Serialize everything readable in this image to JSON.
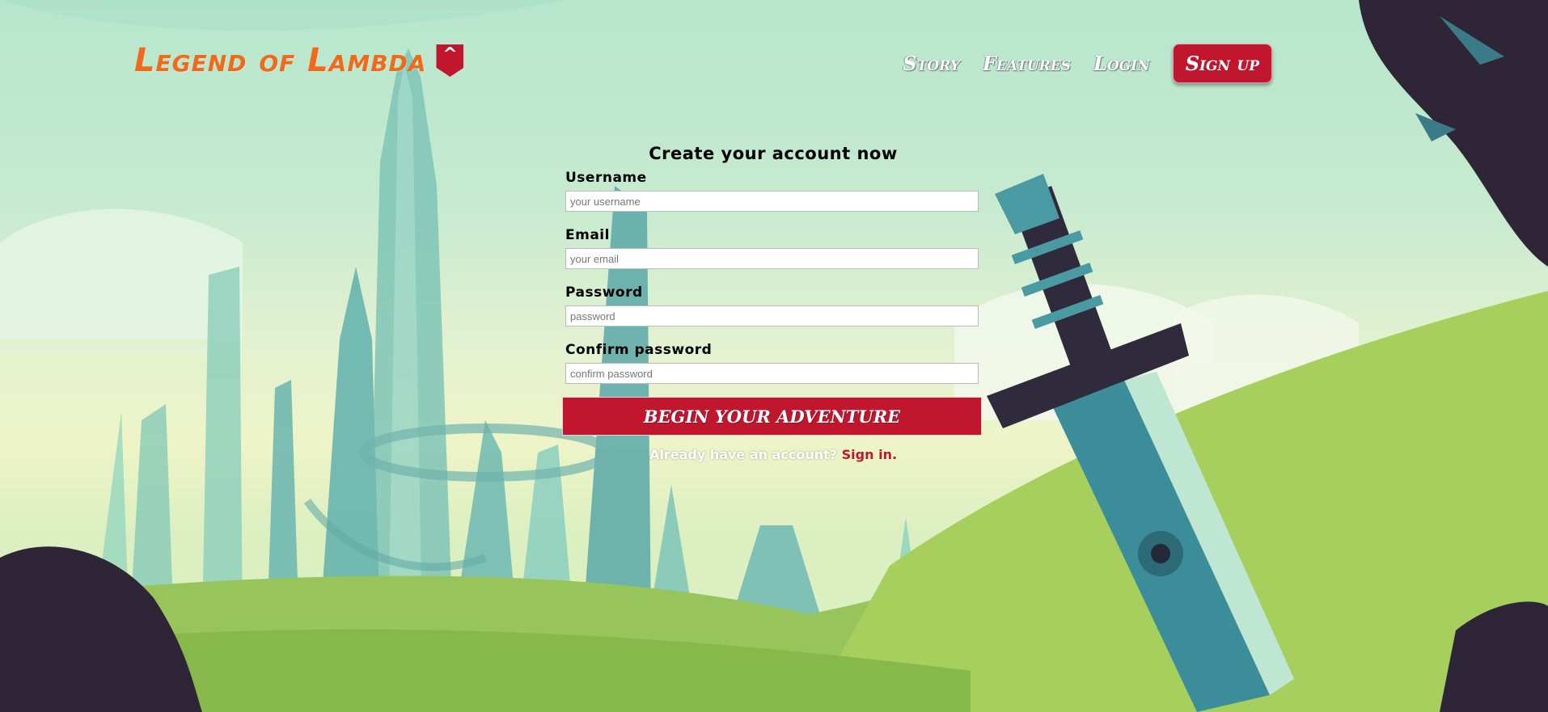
{
  "brand": {
    "logo_text": "Legend of Lambda",
    "badge_glyph": "^",
    "brand_color": "#c0172f",
    "logo_color": "#f06a1c"
  },
  "nav": {
    "links": [
      "Story",
      "Features",
      "Login"
    ],
    "signup_label": "Sign up"
  },
  "form": {
    "title": "Create your account now",
    "fields": [
      {
        "label": "Username",
        "placeholder": "your username",
        "type": "text"
      },
      {
        "label": "Email",
        "placeholder": "your email",
        "type": "email"
      },
      {
        "label": "Password",
        "placeholder": "password",
        "type": "password"
      },
      {
        "label": "Confirm password",
        "placeholder": "confirm password",
        "type": "password"
      }
    ],
    "submit_label": "BEGIN YOUR ADVENTURE",
    "signin_prompt": "Already have an account?",
    "signin_link": "Sign in."
  },
  "background": {
    "scene": "illustration",
    "icons": [
      "crystal-city-illustration",
      "sword-illustration",
      "hills-illustration"
    ]
  }
}
